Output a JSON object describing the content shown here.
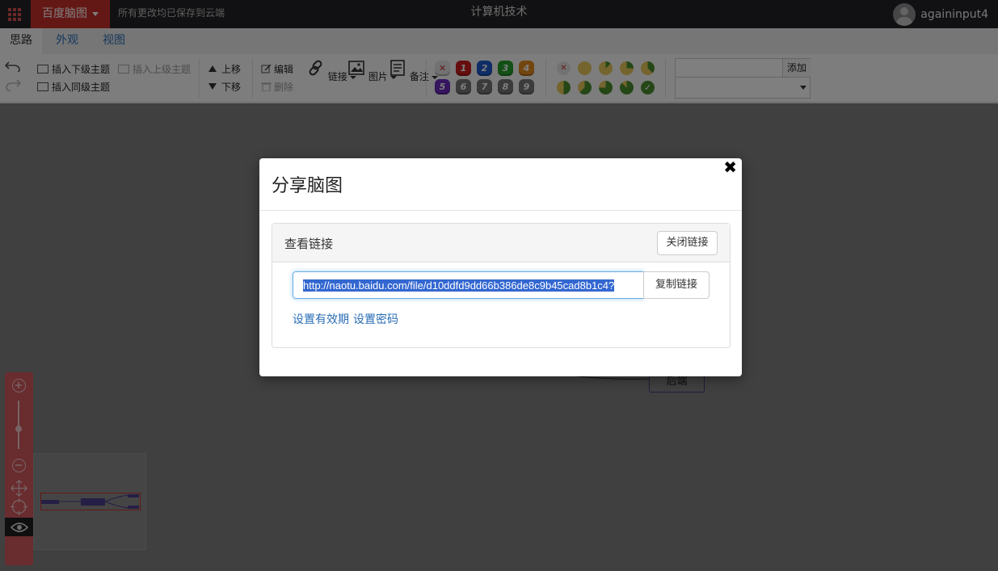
{
  "topbar": {
    "brand": "百度脑图",
    "save_status": "所有更改均已保存到云端",
    "document_title": "计算机技术",
    "username": "againinput4"
  },
  "tabs": [
    {
      "label": "思路",
      "active": true
    },
    {
      "label": "外观",
      "active": false
    },
    {
      "label": "视图",
      "active": false
    }
  ],
  "toolbar": {
    "insert_child": "插入下级主题",
    "insert_parent": "插入上级主题",
    "insert_sibling": "插入同级主题",
    "move_up": "上移",
    "move_down": "下移",
    "edit": "编辑",
    "delete": "删除",
    "link": "链接",
    "image": "图片",
    "note": "备注",
    "priorities": [
      "1",
      "2",
      "3",
      "4",
      "5",
      "6",
      "7",
      "8",
      "9"
    ],
    "priority_colors": [
      "#cc1d1d",
      "#1d5acc",
      "#27a02b",
      "#e68a1e",
      "#6a2cbf",
      "#777777",
      "#777777",
      "#777777",
      "#777777"
    ],
    "progress_levels": 9,
    "resource_add": "添加"
  },
  "canvas": {
    "node_label": "后端"
  },
  "modal": {
    "title": "分享脑图",
    "close_icon": "close-icon",
    "panel_title": "查看链接",
    "close_link_button": "关闭链接",
    "share_url": "http://naotu.baidu.com/file/d10ddfd9dd66b386de8c9b45cad8b1c4?",
    "copy_button": "复制链接",
    "set_expiry": "设置有效期",
    "set_password": "设置密码"
  }
}
